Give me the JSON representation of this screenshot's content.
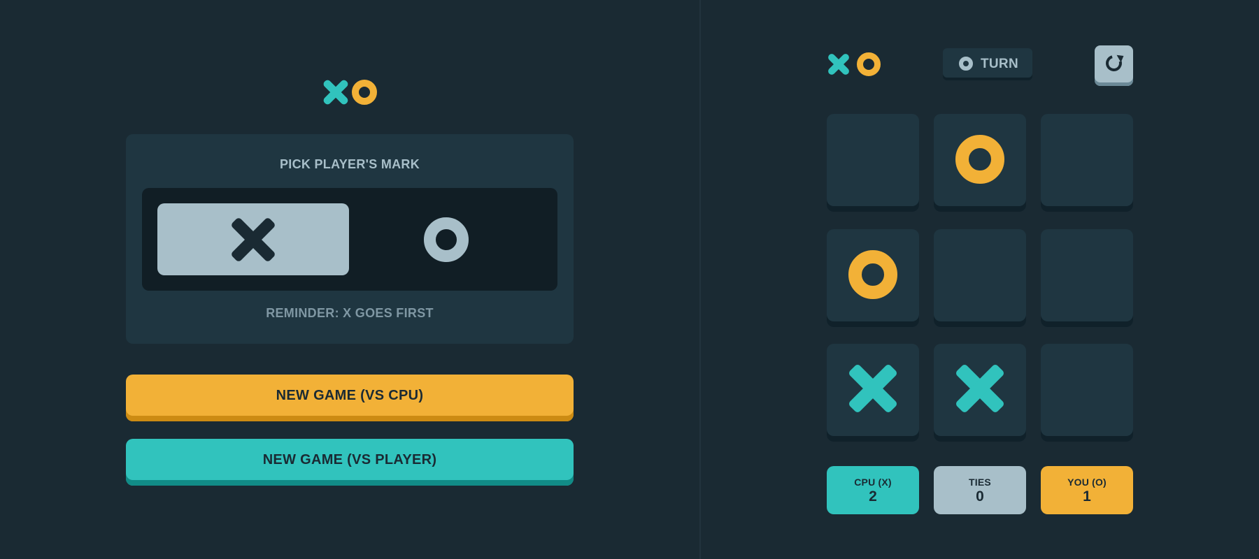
{
  "menu": {
    "logo_icons": [
      "x-mark-icon",
      "o-mark-icon"
    ],
    "pick_title": "PICK PLAYER'S MARK",
    "options": [
      {
        "mark": "X",
        "icon": "x-mark-icon",
        "selected": true
      },
      {
        "mark": "O",
        "icon": "o-mark-icon",
        "selected": false
      }
    ],
    "reminder": "REMINDER: X GOES FIRST",
    "new_game_cpu_label": "NEW GAME (VS CPU)",
    "new_game_player_label": "NEW GAME (VS PLAYER)"
  },
  "game": {
    "turn": {
      "mark": "O",
      "icon": "o-mark-icon",
      "label": "TURN"
    },
    "restart_icon": "restart-icon",
    "board": [
      [
        "",
        "O",
        ""
      ],
      [
        "O",
        "",
        ""
      ],
      [
        "X",
        "X",
        ""
      ]
    ],
    "scores": {
      "cpu": {
        "label": "CPU (X)",
        "value": "2"
      },
      "ties": {
        "label": "TIES",
        "value": "0"
      },
      "you": {
        "label": "YOU (O)",
        "value": "1"
      }
    }
  },
  "colors": {
    "background": "#1a2a33",
    "panel": "#1f3641",
    "x_color": "#31c3bd",
    "o_color": "#f2b137",
    "silver": "#a8bfc9"
  }
}
